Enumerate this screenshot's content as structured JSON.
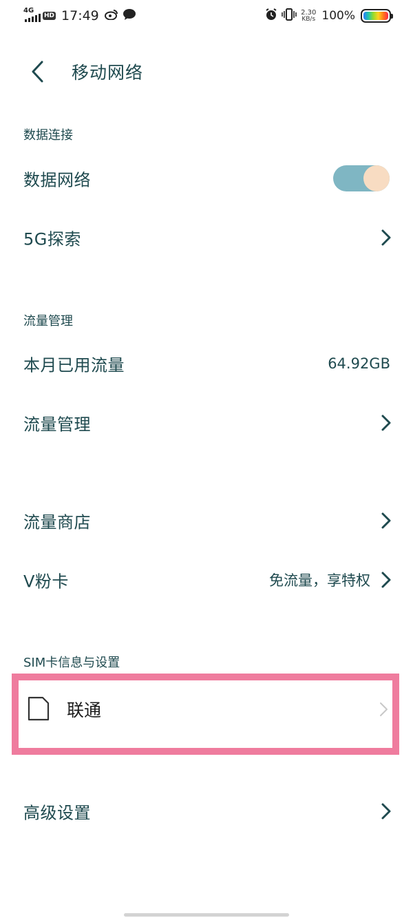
{
  "status_bar": {
    "network": "4G",
    "hd": "HD",
    "time": "17:49",
    "speed_value": "2.30",
    "speed_unit": "KB/s",
    "battery_percent": "100%",
    "icons": [
      "signal-icon",
      "weibo-icon",
      "chat-icon",
      "alarm-icon",
      "vibrate-icon",
      "battery-icon"
    ]
  },
  "header": {
    "title": "移动网络"
  },
  "sections": {
    "data_connection": {
      "title": "数据连接",
      "data_network_label": "数据网络",
      "data_network_on": true,
      "explore_5g_label": "5G探索"
    },
    "traffic": {
      "title": "流量管理",
      "used_label": "本月已用流量",
      "used_value": "64.92GB",
      "manage_label": "流量管理"
    },
    "store": {
      "store_label": "流量商店",
      "vcard_label": "V粉卡",
      "vcard_sub": "免流量，享特权"
    },
    "sim": {
      "title": "SIM卡信息与设置",
      "carrier": "联通"
    },
    "advanced": {
      "label": "高级设置"
    }
  },
  "colors": {
    "text": "#1f4a4f",
    "toggle_track": "#7fb6c3",
    "toggle_knob": "#f8dcc2",
    "highlight_border": "#ef7c9e"
  }
}
